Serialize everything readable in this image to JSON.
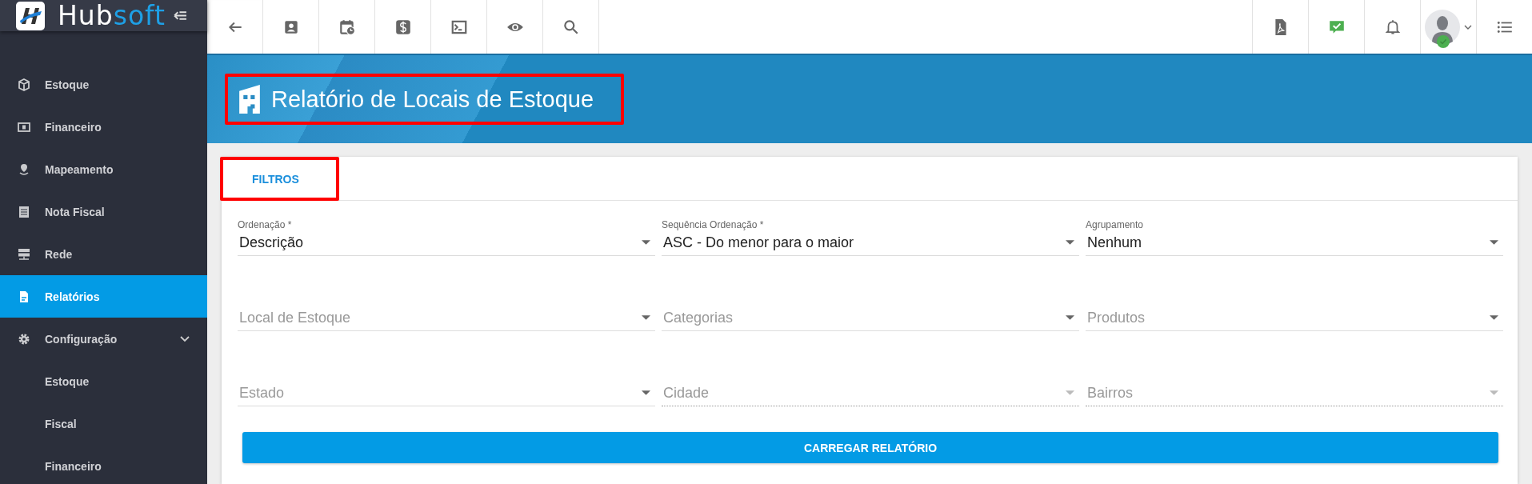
{
  "brand": {
    "text": "Hub",
    "accent": "soft"
  },
  "sidebar": {
    "items": [
      {
        "label": "Estoque",
        "selected": false
      },
      {
        "label": "Financeiro",
        "selected": false
      },
      {
        "label": "Mapeamento",
        "selected": false
      },
      {
        "label": "Nota Fiscal",
        "selected": false
      },
      {
        "label": "Rede",
        "selected": false
      },
      {
        "label": "Relatórios",
        "selected": true
      },
      {
        "label": "Configuração",
        "selected": false,
        "expanded": true,
        "children": [
          {
            "label": "Estoque",
            "selected": false
          },
          {
            "label": "Fiscal",
            "selected": false
          },
          {
            "label": "Financeiro",
            "selected": false
          }
        ]
      }
    ]
  },
  "user": {
    "online": true
  },
  "header": {
    "title": "Relatório de Locais de Estoque",
    "annotated": true
  },
  "tabs": [
    {
      "label": "FILTROS",
      "selected": true,
      "annotated": true
    }
  ],
  "fields": [
    {
      "label": "Ordenação *",
      "value": "Descrição",
      "disabled": false
    },
    {
      "label": "Sequência Ordenação *",
      "value": "ASC - Do menor para o maior",
      "disabled": false
    },
    {
      "label": "Agrupamento",
      "value": "Nenhum",
      "disabled": false
    },
    {
      "placeholder": "Local de Estoque",
      "disabled": false
    },
    {
      "placeholder": "Categorias",
      "disabled": false
    },
    {
      "placeholder": "Produtos",
      "disabled": false
    },
    {
      "placeholder": "Estado",
      "disabled": false
    },
    {
      "placeholder": "Cidade",
      "disabled": true
    },
    {
      "placeholder": "Bairros",
      "disabled": true
    }
  ],
  "submit": "CARREGAR RELATÓRIO"
}
